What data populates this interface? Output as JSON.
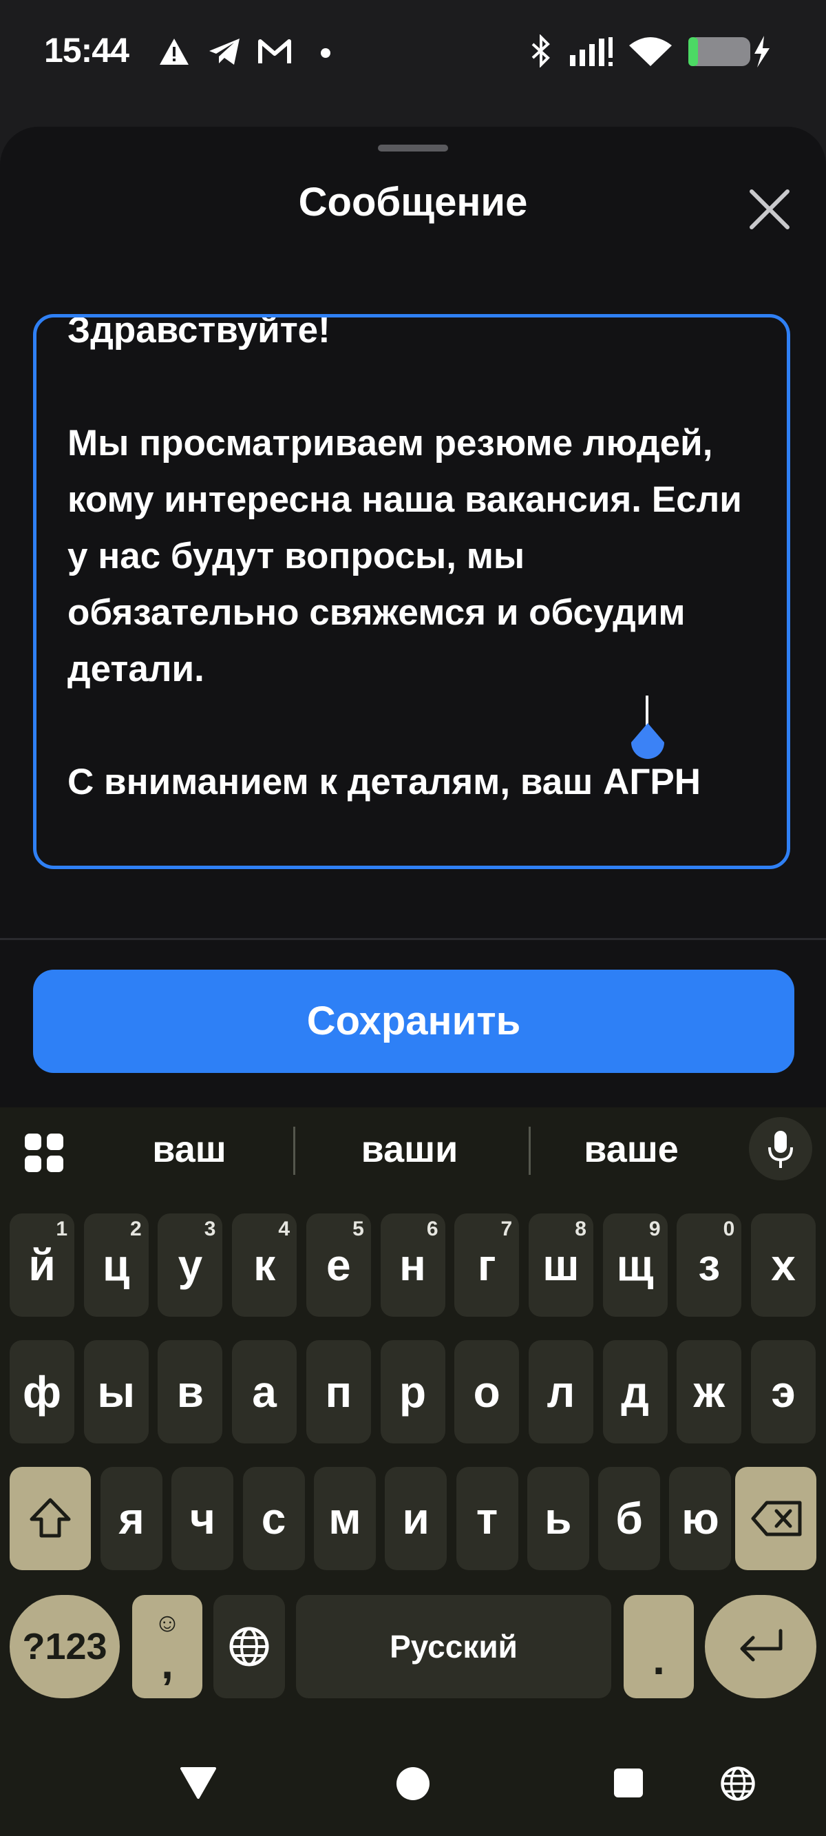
{
  "status_bar": {
    "time": "15:44",
    "icons": [
      "warning-icon",
      "telegram-icon",
      "gmail-icon",
      "dot-icon",
      "bluetooth-icon",
      "signal-icon",
      "wifi-icon",
      "battery-icon"
    ]
  },
  "sheet": {
    "title": "Сообщение",
    "message_text": "Здравствуйте!\n\nМы просматриваем резюме людей, кому интересна наша вакансия. Если у нас будут вопросы, мы обязательно свяжемся и обсудим детали.\n\nС вниманием к деталям, ваш АГРН",
    "save_label": "Сохранить",
    "accent_color": "#2e80f6"
  },
  "keyboard": {
    "suggestions": [
      "ваш",
      "ваши",
      "ваше"
    ],
    "row1": [
      {
        "k": "й",
        "h": "1"
      },
      {
        "k": "ц",
        "h": "2"
      },
      {
        "k": "у",
        "h": "3"
      },
      {
        "k": "к",
        "h": "4"
      },
      {
        "k": "е",
        "h": "5"
      },
      {
        "k": "н",
        "h": "6"
      },
      {
        "k": "г",
        "h": "7"
      },
      {
        "k": "ш",
        "h": "8"
      },
      {
        "k": "щ",
        "h": "9"
      },
      {
        "k": "з",
        "h": "0"
      },
      {
        "k": "х",
        "h": ""
      }
    ],
    "row2": [
      "ф",
      "ы",
      "в",
      "а",
      "п",
      "р",
      "о",
      "л",
      "д",
      "ж",
      "э"
    ],
    "row3": [
      "я",
      "ч",
      "с",
      "м",
      "и",
      "т",
      "ь",
      "б",
      "ю"
    ],
    "symbols_label": "?123",
    "comma_label": ",",
    "space_label": "Русский",
    "period_label": "."
  }
}
